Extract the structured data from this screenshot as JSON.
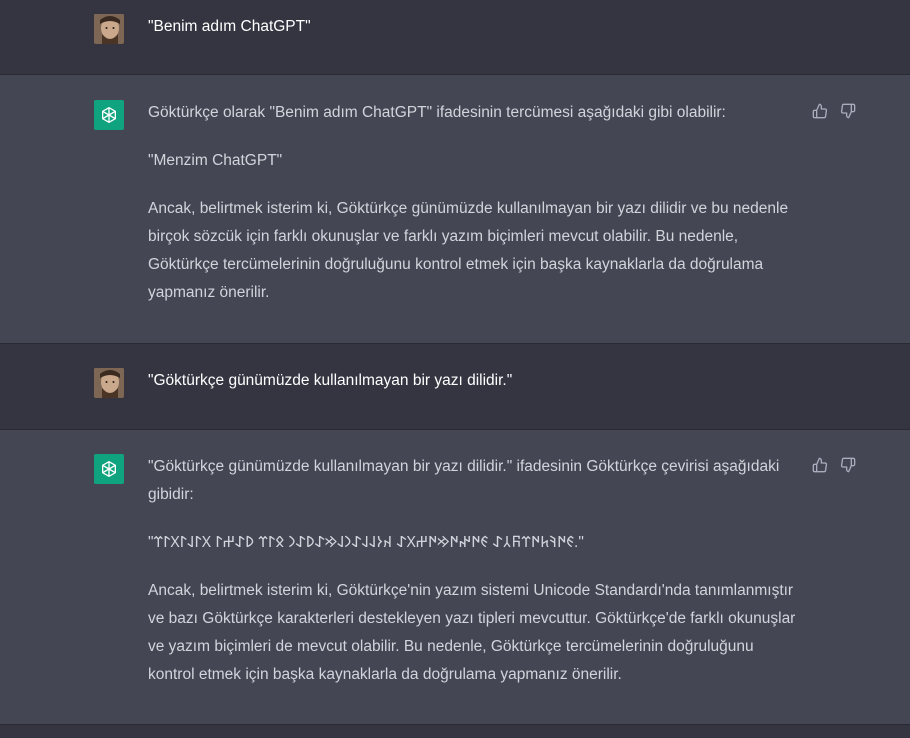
{
  "conversation": {
    "messages": [
      {
        "role": "user",
        "paragraphs": [
          "\"Benim adım ChatGPT\""
        ]
      },
      {
        "role": "assistant",
        "paragraphs": [
          "Göktürkçe olarak \"Benim adım ChatGPT\" ifadesinin tercümesi aşağıdaki gibi olabilir:",
          "\"Menzim ChatGPT\"",
          "Ancak, belirtmek isterim ki, Göktürkçe günümüzde kullanılmayan bir yazı dilidir ve bu nedenle birçok sözcük için farklı okunuşlar ve farklı yazım biçimleri mevcut olabilir. Bu nedenle, Göktürkçe tercümelerinin doğruluğunu kontrol etmek için başka kaynaklarla da doğrulama yapmanız önerilir."
        ]
      },
      {
        "role": "user",
        "paragraphs": [
          "\"Göktürkçe günümüzde kullanılmayan bir yazı dilidir.\""
        ]
      },
      {
        "role": "assistant",
        "paragraphs": [
          "\"Göktürkçe günümüzde kullanılmayan bir yazı dilidir.\" ifadesinin Göktürkçe çevirisi aşağıdaki gibidir:",
          "\"𐰏𐰇𐰚𐱅𐰇𐰼𐰜𐰲𐰀 𐰏𐰇𐰤𐰇𐰢𐰇𐰔𐰓𐰀 𐰴𐰆𐰞𐰞𐰀𐰣𐰞𐰢𐰀𐰖𐰀𐰣 𐰋𐰃𐰼 𐰖𐰀𐰔𐰃 𐰓𐰃𐰞𐰃𐰓𐰃𐰼.\"",
          "Ancak, belirtmek isterim ki, Göktürkçe'nin yazım sistemi Unicode Standardı'nda tanımlanmıştır ve bazı Göktürkçe karakterleri destekleyen yazı tipleri mevcuttur. Göktürkçe'de farklı okunuşlar ve yazım biçimleri de mevcut olabilir. Bu nedenle, Göktürkçe tercümelerinin doğruluğunu kontrol etmek için başka kaynaklarla da doğrulama yapmanız önerilir."
        ]
      }
    ]
  },
  "icons": {
    "thumbs_up": "thumbs-up-icon",
    "thumbs_down": "thumbs-down-icon",
    "assistant_logo": "openai-logo-icon"
  },
  "colors": {
    "user_bg": "#343541",
    "assistant_bg": "#444654",
    "assistant_avatar": "#10a37f"
  }
}
